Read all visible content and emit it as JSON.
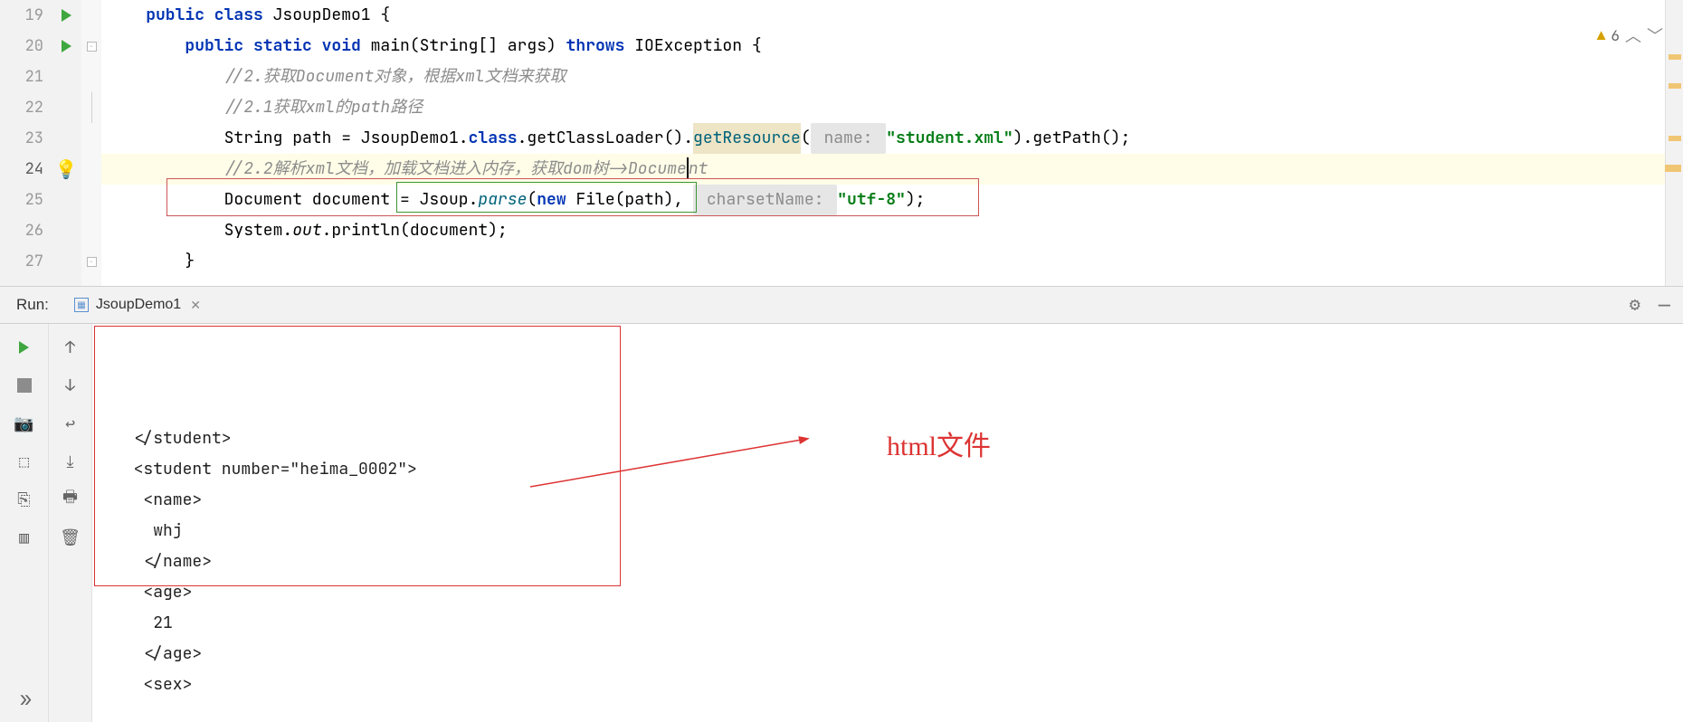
{
  "editor": {
    "lines": [
      {
        "num": "19",
        "runIcon": true,
        "fold": "open",
        "tokens": [
          {
            "t": "    ",
            "c": ""
          },
          {
            "t": "public class ",
            "c": "kw"
          },
          {
            "t": "JsoupDemo1 {",
            "c": ""
          }
        ]
      },
      {
        "num": "20",
        "runIcon": true,
        "fold": "open",
        "tokens": [
          {
            "t": "        ",
            "c": ""
          },
          {
            "t": "public static void ",
            "c": "kw"
          },
          {
            "t": "main(String[] args) ",
            "c": ""
          },
          {
            "t": "throws ",
            "c": "kw"
          },
          {
            "t": "IOException {",
            "c": ""
          }
        ]
      },
      {
        "num": "21",
        "tokens": [
          {
            "t": "            ",
            "c": ""
          },
          {
            "t": "//2.获取Document对象，根据xml文档来获取",
            "c": "comment"
          }
        ]
      },
      {
        "num": "22",
        "fold": "openline",
        "tokens": [
          {
            "t": "            ",
            "c": ""
          },
          {
            "t": "//2.1获取xml的path路径",
            "c": "comment"
          }
        ]
      },
      {
        "num": "23",
        "tokens": [
          {
            "t": "            ",
            "c": ""
          },
          {
            "t": "String path = JsoupDemo1.",
            "c": ""
          },
          {
            "t": "class",
            "c": "kw"
          },
          {
            "t": ".getClassLoader().",
            "c": ""
          },
          {
            "t": "getResource",
            "c": "method highlight-res"
          },
          {
            "t": "(",
            "c": ""
          },
          {
            "t": " name: ",
            "c": "hint"
          },
          {
            "t": "\"student.xml\"",
            "c": "str"
          },
          {
            "t": ").getPath();",
            "c": ""
          }
        ]
      },
      {
        "num": "24",
        "current": true,
        "bulb": true,
        "tokens": [
          {
            "t": "            ",
            "c": ""
          },
          {
            "t": "//2.2解析xml文档，加载文档进入内存，获取dom树->Docume",
            "c": "comment"
          },
          {
            "t": "|",
            "c": "caret"
          },
          {
            "t": "nt",
            "c": "comment"
          }
        ]
      },
      {
        "num": "25",
        "tokens": [
          {
            "t": "            ",
            "c": ""
          },
          {
            "t": "Document document = ",
            "c": ""
          },
          {
            "t": "Jsoup.",
            "c": ""
          },
          {
            "t": "parse",
            "c": "method italic-method"
          },
          {
            "t": "(",
            "c": ""
          },
          {
            "t": "new ",
            "c": "kw"
          },
          {
            "t": "File(path), ",
            "c": ""
          },
          {
            "t": " charsetName: ",
            "c": "hint"
          },
          {
            "t": "\"utf-8\"",
            "c": "str"
          },
          {
            "t": ");",
            "c": ""
          }
        ]
      },
      {
        "num": "26",
        "tokens": [
          {
            "t": "            ",
            "c": ""
          },
          {
            "t": "System.",
            "c": ""
          },
          {
            "t": "out",
            "c": "italic-method"
          },
          {
            "t": ".println(document);",
            "c": ""
          }
        ]
      },
      {
        "num": "27",
        "fold": "close",
        "tokens": [
          {
            "t": "        }",
            "c": ""
          }
        ]
      }
    ],
    "warnings_count": "6"
  },
  "run_panel": {
    "label": "Run:",
    "tab_name": "JsoupDemo1"
  },
  "console": {
    "lines": [
      "  </student>",
      "  <student number=\"heima_0002\">",
      "   <name>",
      "    whj",
      "   </name>",
      "   <age>",
      "    21",
      "   </age>",
      "   <sex>"
    ]
  },
  "annotation": {
    "label": "html文件"
  }
}
